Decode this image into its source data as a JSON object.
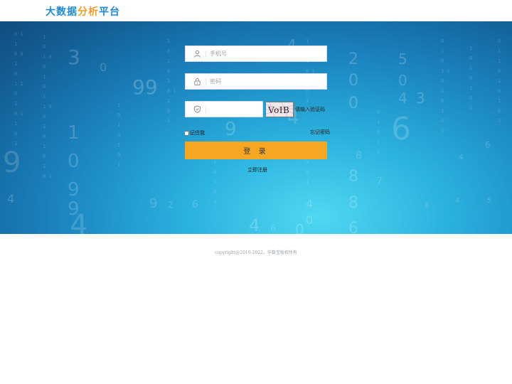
{
  "header": {
    "logo_part1": "大数据",
    "logo_part2": "分析",
    "logo_part3": "平台"
  },
  "form": {
    "phone_placeholder": "手机号",
    "password_placeholder": "密码",
    "captcha_value": "",
    "captcha_text": "VoIB",
    "captcha_tip": "请输入验证码",
    "remember_label": "记住我",
    "forgot_label": "忘记密码",
    "login_label": "登 录",
    "register_label": "立即注册",
    "icons": [
      "user-icon",
      "lock-icon",
      "shield-icon"
    ]
  },
  "footer": {
    "copyright": "copyright@2010-2022，华数宝版权所有"
  },
  "colors": {
    "accent": "#f5a623",
    "logo_blue": "#1f8ad3",
    "logo_orange": "#f59b23",
    "banner_dark": "#135d94",
    "banner_light": "#4fd8f2"
  }
}
